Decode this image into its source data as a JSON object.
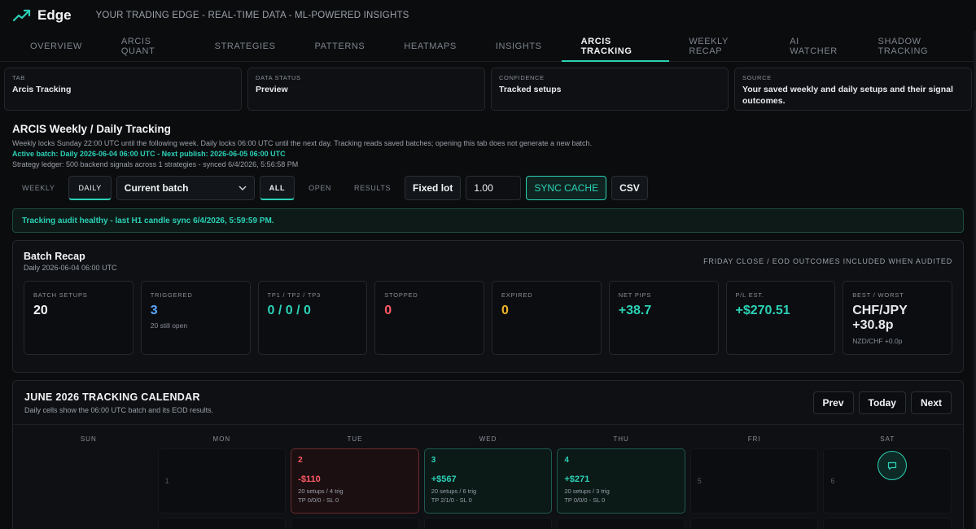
{
  "app": {
    "name": "Edge",
    "tagline": "YOUR TRADING EDGE - REAL-TIME DATA - ML-POWERED INSIGHTS",
    "accent": "#2bd1b6"
  },
  "nav": {
    "tabs": [
      {
        "label": "OVERVIEW"
      },
      {
        "label": "ARCIS QUANT"
      },
      {
        "label": "STRATEGIES"
      },
      {
        "label": "PATTERNS"
      },
      {
        "label": "HEATMAPS"
      },
      {
        "label": "INSIGHTS"
      },
      {
        "label": "ARCIS TRACKING"
      },
      {
        "label": "WEEKLY RECAP"
      },
      {
        "label": "AI WATCHER"
      },
      {
        "label": "SHADOW TRACKING"
      }
    ],
    "active": "ARCIS TRACKING"
  },
  "info": [
    {
      "label": "TAB",
      "value": "Arcis Tracking"
    },
    {
      "label": "DATA STATUS",
      "value": "Preview"
    },
    {
      "label": "CONFIDENCE",
      "value": "Tracked setups"
    },
    {
      "label": "SOURCE",
      "value": "Your saved weekly and daily setups and their signal outcomes."
    }
  ],
  "page": {
    "title": "ARCIS Weekly / Daily Tracking",
    "description": "Weekly locks Sunday 22:00 UTC until the following week. Daily locks 06:00 UTC until the next day. Tracking reads saved batches; opening this tab does not generate a new batch.",
    "active_batch": "Active batch: Daily 2026-06-04 06:00 UTC - Next publish: 2026-06-05 06:00 UTC",
    "ledger": "Strategy ledger: 500 backend signals across 1 strategies - synced 6/4/2026, 5:56:58 PM"
  },
  "toolbar": {
    "weekly": "WEEKLY",
    "daily": "DAILY",
    "batch_select": "Current batch",
    "all": "ALL",
    "open": "OPEN",
    "results": "RESULTS",
    "fixed_lot": "Fixed lot",
    "lot_value": "1.00",
    "sync": "SYNC CACHE",
    "csv": "CSV"
  },
  "audit": {
    "message": "Tracking audit healthy - last H1 candle sync 6/4/2026, 5:59:59 PM."
  },
  "recap": {
    "title": "Batch Recap",
    "subtitle": "Daily 2026-06-04 06:00 UTC",
    "note": "FRIDAY CLOSE / EOD OUTCOMES INCLUDED WHEN AUDITED",
    "stats": [
      {
        "label": "BATCH SETUPS",
        "value": "20",
        "sub": "",
        "color": "#f2f4f6"
      },
      {
        "label": "TRIGGERED",
        "value": "3",
        "sub": "20 still open",
        "color": "#5aa8ff"
      },
      {
        "label": "TP1 / TP2 / TP3",
        "value": "0 / 0 / 0",
        "sub": "",
        "color": "#2bd1b6"
      },
      {
        "label": "STOPPED",
        "value": "0",
        "sub": "",
        "color": "#ff5a66"
      },
      {
        "label": "EXPIRED",
        "value": "0",
        "sub": "",
        "color": "#f0b429"
      },
      {
        "label": "NET PIPS",
        "value": "+38.7",
        "sub": "",
        "color": "#2bd1b6"
      },
      {
        "label": "P/L EST.",
        "value": "+$270.51",
        "sub": "",
        "color": "#2bd1b6"
      },
      {
        "label": "BEST / WORST",
        "value": "CHF/JPY +30.8p",
        "sub": "NZD/CHF +0.0p",
        "color": "#e6e8eb"
      }
    ]
  },
  "calendar": {
    "title": "JUNE 2026 TRACKING CALENDAR",
    "subtitle": "Daily cells show the 06:00 UTC batch and its EOD results.",
    "prev": "Prev",
    "today": "Today",
    "next": "Next",
    "weekdays": [
      "SUN",
      "MON",
      "TUE",
      "WED",
      "THU",
      "FRI",
      "SAT"
    ],
    "week1": [
      {
        "type": "empty"
      },
      {
        "type": "plain",
        "day": "1"
      },
      {
        "type": "loss",
        "day": "2",
        "pnl": "-$110",
        "setups": "20 setups / 4 trig",
        "tp": "TP 0/0/0 - SL 0"
      },
      {
        "type": "gain",
        "day": "3",
        "pnl": "+$567",
        "setups": "20 setups / 6 trig",
        "tp": "TP 2/1/0 - SL 0"
      },
      {
        "type": "gain",
        "day": "4",
        "pnl": "+$271",
        "setups": "20 setups / 3 trig",
        "tp": "TP 0/0/0 - SL 0"
      },
      {
        "type": "plain",
        "day": "5"
      },
      {
        "type": "plain",
        "day": "6"
      }
    ]
  },
  "icons": {
    "logo": "trend-up-icon",
    "dropdown": "chevron-down-icon",
    "chat": "chat-bubble-icon"
  }
}
